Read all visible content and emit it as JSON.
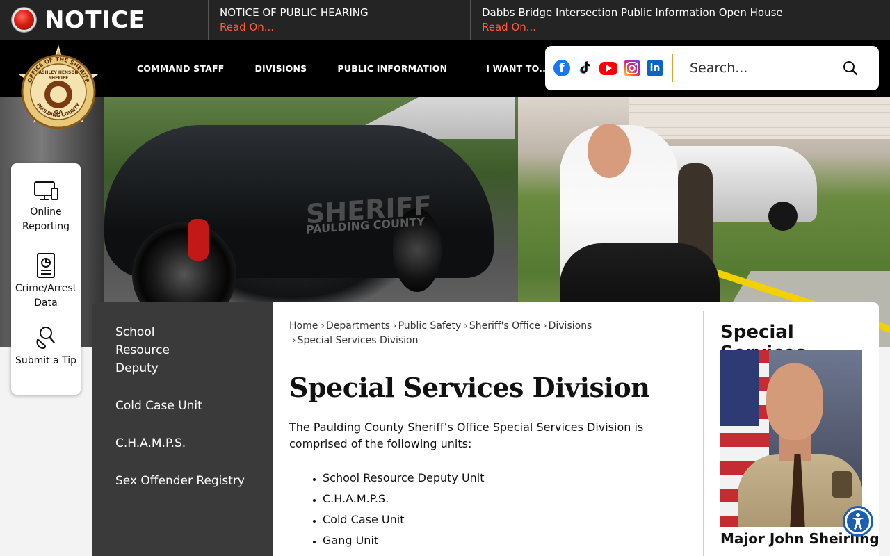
{
  "notice": {
    "label": "NOTICE",
    "items": [
      {
        "title": "NOTICE OF PUBLIC HEARING",
        "link": "Read On..."
      },
      {
        "title": "Dabbs Bridge Intersection Public Information Open House",
        "link": "Read On..."
      }
    ]
  },
  "logo": {
    "text_top": "OFFICE OF THE SHERIFF",
    "text_name": "ASHLEY HENSON",
    "text_role": "SHERIFF",
    "text_state": "GA",
    "text_county": "PAULDING COUNTY"
  },
  "nav": {
    "items": [
      "COMMAND STAFF",
      "DIVISIONS",
      "PUBLIC INFORMATION",
      "I WANT TO..."
    ]
  },
  "social": {
    "icons": [
      "facebook-icon",
      "tiktok-icon",
      "youtube-icon",
      "instagram-icon",
      "linkedin-icon"
    ]
  },
  "search": {
    "placeholder": "Search..."
  },
  "hero": {
    "door_big": "SHERIFF",
    "door_text": "PAULDING COUNTY"
  },
  "quick_links": [
    {
      "label": "Online Reporting",
      "icon": "computer-monitor-icon"
    },
    {
      "label": "Crime/Arrest Data",
      "icon": "document-icon"
    },
    {
      "label": "Submit a Tip",
      "icon": "footprint-search-icon"
    }
  ],
  "sidenav": {
    "items": [
      "School Resource Deputy",
      "Cold Case Unit",
      "C.H.A.M.P.S.",
      "Sex Offender Registry"
    ]
  },
  "breadcrumb": [
    "Home",
    "Departments",
    "Public Safety",
    "Sheriff's Office",
    "Divisions",
    "Special Services Division"
  ],
  "page": {
    "title": "Special Services Division",
    "intro": "The Paulding County Sheriff’s Office Special Services Division is comprised of the following units:",
    "units": [
      "School Resource Deputy Unit",
      "C.H.A.M.P.S.",
      "Cold Case Unit",
      "Gang Unit"
    ]
  },
  "aside": {
    "title": "Special Services",
    "name": "Major John Sheirling"
  },
  "colors": {
    "notice_bg": "#242424",
    "notice_link": "#ff5a3c",
    "header_bg": "#000000",
    "sidenav_bg": "#3a3a3a",
    "search_divider": "#e0a030",
    "accessibility": "#1b5fb4"
  }
}
